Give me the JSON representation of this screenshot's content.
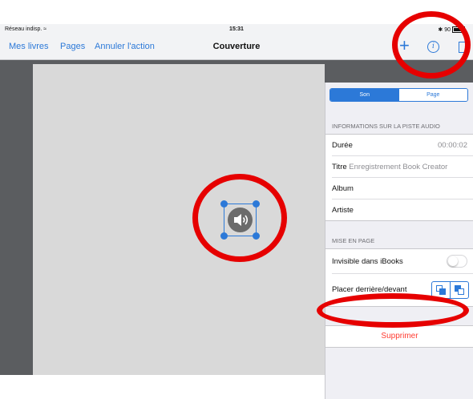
{
  "status": {
    "network": "Réseau indisp.",
    "time": "15:31",
    "battery": "90"
  },
  "navbar": {
    "back": "Mes livres",
    "pages": "Pages",
    "undo": "Annuler l'action",
    "title": "Couverture",
    "add_glyph": "+",
    "info_glyph": "i"
  },
  "panel": {
    "segment": {
      "active": "Son",
      "inactive": "Page"
    },
    "audio_section": "INFORMATIONS SUR LA PISTE AUDIO",
    "audio_rows": [
      {
        "label": "Durée",
        "value": "00:00:02"
      },
      {
        "label": "Titre",
        "value": "Enregistrement Book Creator"
      },
      {
        "label": "Album",
        "value": ""
      },
      {
        "label": "Artiste",
        "value": ""
      }
    ],
    "layout_section": "MISE EN PAGE",
    "invisible_label": "Invisible dans iBooks",
    "invisible_on": false,
    "arrange_label": "Placer derrière/devant",
    "delete_label": "Supprimer"
  },
  "icons": [
    "speaker-icon",
    "plus-icon",
    "info-icon",
    "bring-back-icon",
    "bring-front-icon"
  ],
  "colors": {
    "accent": "#2c79d8",
    "delete": "#ff3b30",
    "highlight": "#e60000"
  }
}
